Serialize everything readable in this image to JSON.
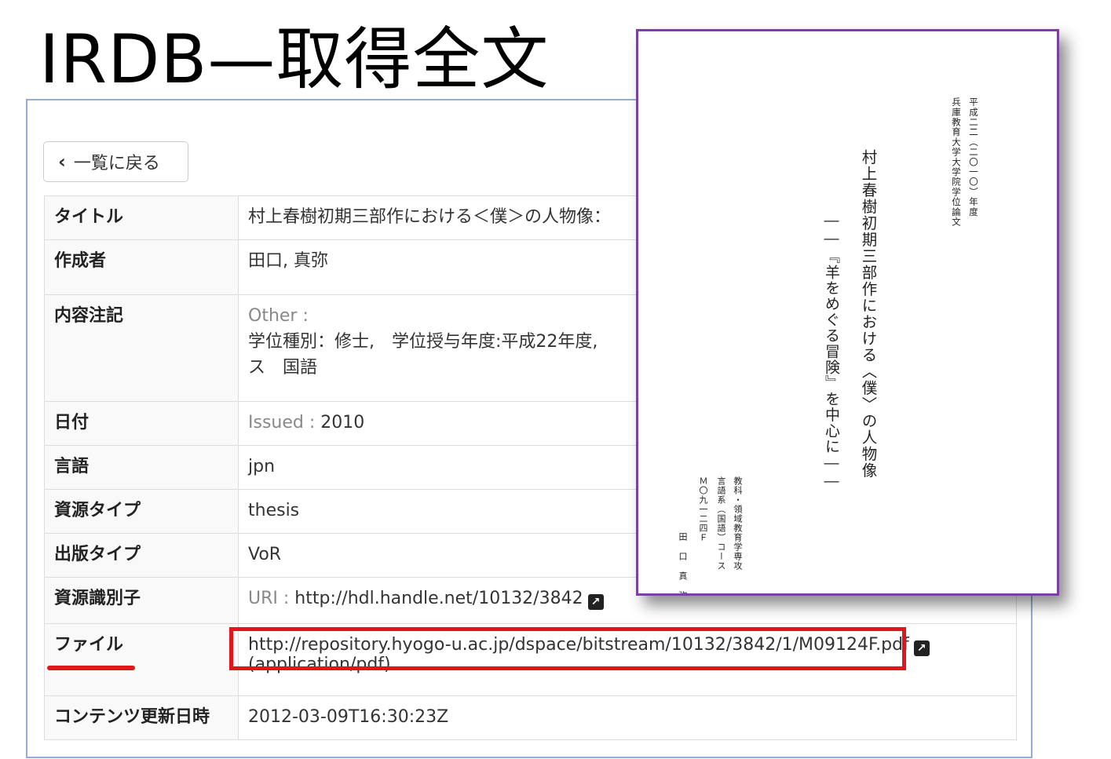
{
  "slide": {
    "title": "IRDB—取得全文"
  },
  "back_button": {
    "label": "一覧に戻る",
    "icon": "chevron-left-icon"
  },
  "metadata": {
    "title": {
      "label": "タイトル",
      "value": "村上春樹初期三部作における＜僕＞の人物像："
    },
    "creator": {
      "label": "作成者",
      "value": "田口, 真弥"
    },
    "note": {
      "label": "内容注記",
      "type": "Other :",
      "line1": "学位種別：修士,　学位授与年度:平成22年度,",
      "line2": "ス　国語"
    },
    "date": {
      "label": "日付",
      "type": "Issued :",
      "value": "2010"
    },
    "language": {
      "label": "言語",
      "value": "jpn"
    },
    "resource_type": {
      "label": "資源タイプ",
      "value": "thesis"
    },
    "publication_type": {
      "label": "出版タイプ",
      "value": "VoR"
    },
    "identifier": {
      "label": "資源識別子",
      "type": "URI :",
      "value": "http://hdl.handle.net/10132/3842",
      "icon": "external-link-icon"
    },
    "file": {
      "label": "ファイル",
      "url": "http://repository.hyogo-u.ac.jp/dspace/bitstream/10132/3842/1/M09124F.pdf",
      "mime": "(application/pdf)",
      "icon": "external-link-icon"
    },
    "updated": {
      "label": "コンテンツ更新日時",
      "value": "2012-03-09T16:30:23Z"
    }
  },
  "highlight_color": "#e0161d",
  "preview": {
    "year": "平成二二（二〇一〇）年度",
    "university": "兵庫教育大学大学院学位論文",
    "title": "村上春樹初期三部作における〈僕〉の人物像",
    "subtitle": "――『羊をめぐる冒険』を中心に――",
    "department": "教科・領域教育学専攻",
    "course": "言語系（国語）コース",
    "student_id": "Ｍ〇九一二四Ｆ",
    "author": "田口真弥",
    "border_color": "#7b3fa6"
  }
}
